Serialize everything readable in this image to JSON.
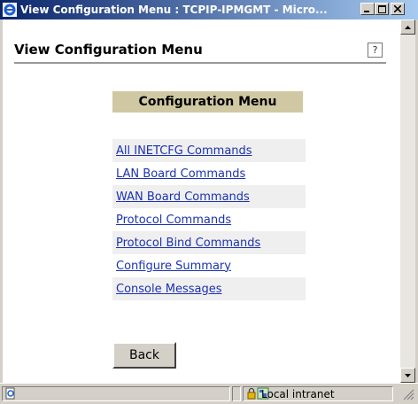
{
  "window": {
    "title": "View Configuration Menu : TCPIP-IPMGMT - Micro..."
  },
  "page": {
    "title": "View Configuration Menu",
    "help_icon": "?"
  },
  "menu": {
    "header": "Configuration Menu",
    "items": [
      {
        "label": "All INETCFG Commands"
      },
      {
        "label": "LAN Board Commands"
      },
      {
        "label": "WAN Board Commands"
      },
      {
        "label": "Protocol Commands"
      },
      {
        "label": "Protocol Bind Commands"
      },
      {
        "label": "Configure Summary"
      },
      {
        "label": "Console Messages"
      }
    ]
  },
  "buttons": {
    "back_label": "Back"
  },
  "statusbar": {
    "zone_label": "Local intranet"
  },
  "colors": {
    "titlebar_start": "#0a246a",
    "menu_header_bg": "#cfc8a2",
    "link": "#1a33b0"
  }
}
